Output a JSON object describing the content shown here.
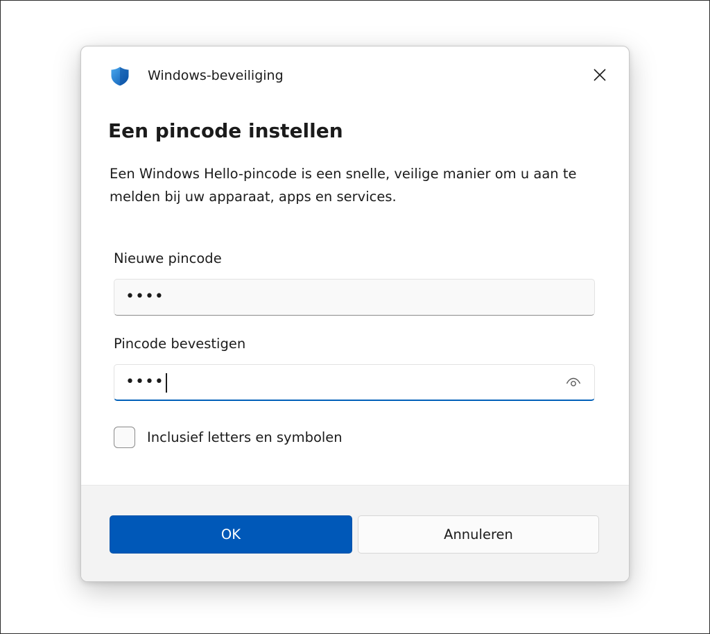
{
  "window": {
    "app_title": "Windows-beveiliging",
    "close_icon": "close-icon",
    "shield_icon": "shield-icon"
  },
  "dialog": {
    "heading": "Een pincode instellen",
    "description": "Een Windows Hello-pincode is een snelle, veilige manier om u aan te melden bij uw apparaat, apps en services."
  },
  "fields": {
    "new_pin": {
      "label": "Nieuwe pincode",
      "value": "••••"
    },
    "confirm_pin": {
      "label": "Pincode bevestigen",
      "value": "••••",
      "reveal_icon": "eye-icon"
    }
  },
  "options": {
    "include_letters_label": "Inclusief letters en symbolen",
    "include_letters_checked": false
  },
  "buttons": {
    "ok_label": "OK",
    "cancel_label": "Annuleren"
  },
  "colors": {
    "accent": "#0058b8",
    "shield_light": "#3a96dd",
    "shield_dark": "#0f5fb8"
  }
}
